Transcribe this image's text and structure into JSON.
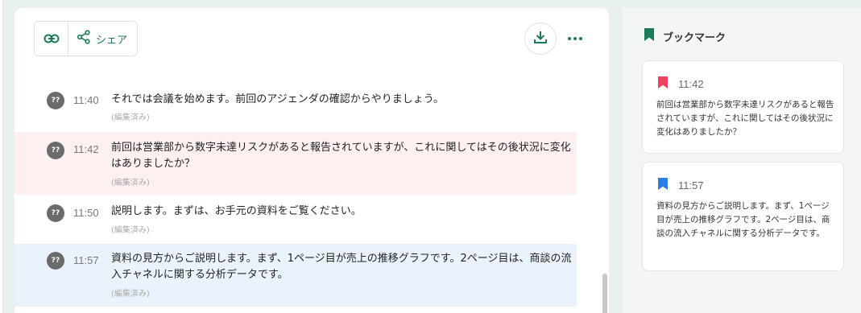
{
  "toolbar": {
    "link_icon": "link-icon",
    "share_icon": "share-icon",
    "share_label": "シェア",
    "download_icon": "download-icon",
    "more_icon": "more-horizontal-icon",
    "accent": "#1f7a57"
  },
  "transcript": [
    {
      "avatar_label": "??",
      "time": "11:40",
      "text": "それでは会議を始めます。前回のアジェンダの確認からやりましょう。",
      "edited": "(編集済み)",
      "highlight": "none"
    },
    {
      "avatar_label": "??",
      "time": "11:42",
      "text": "前回は営業部から数字未達リスクがあると報告されていますが、これに関してはその後状況に変化はありましたか？",
      "edited": "(編集済み)",
      "highlight": "red"
    },
    {
      "avatar_label": "??",
      "time": "11:50",
      "text": "説明します。まずは、お手元の資料をご覧ください。",
      "edited": "(編集済み)",
      "highlight": "none"
    },
    {
      "avatar_label": "??",
      "time": "11:57",
      "text": "資料の見方からご説明します。まず、1ページ目が売上の推移グラフです。2ページ目は、商談の流入チャネルに関する分析データです。",
      "edited": "(編集済み)",
      "highlight": "blue"
    }
  ],
  "bookmarks": {
    "title": "ブックマーク",
    "title_color": "#1f7a57",
    "items": [
      {
        "time": "11:42",
        "color": "#f0425f",
        "text": "前回は営業部から数字未達リスクがあると報告されていますが、これに関してはその後状況に変化はありましたか？"
      },
      {
        "time": "11:57",
        "color": "#2a7de1",
        "text": "資料の見方からご説明します。まず、1ページ目が売上の推移グラフです。2ページ目は、商談の流入チャネルに関する分析データです。"
      }
    ]
  }
}
